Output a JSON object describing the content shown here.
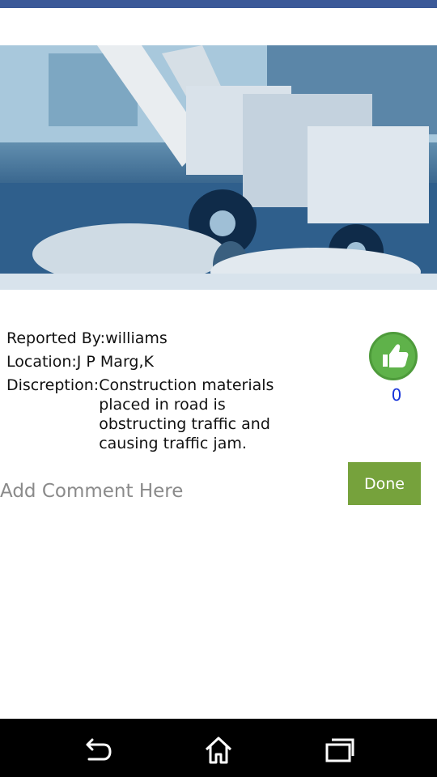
{
  "report": {
    "reported_by_label": "Reported By:",
    "reported_by": "williams",
    "location_label": "Location:",
    "location": "J P Marg,K",
    "description_label": "Discreption:",
    "description": "Construction materials placed in road is obstructing traffic and causing traffic jam."
  },
  "like": {
    "icon": "thumbs-up-icon",
    "count": "0"
  },
  "comment": {
    "placeholder": "Add Comment Here",
    "value": ""
  },
  "done_button": {
    "label": "Done"
  },
  "colors": {
    "status_bar": "#3b5998",
    "like_green": "#5fb24a",
    "count_blue": "#1733d9",
    "done_green": "#76a23c"
  },
  "nav": {
    "back_icon": "back-icon",
    "home_icon": "home-icon",
    "recents_icon": "recents-icon"
  }
}
